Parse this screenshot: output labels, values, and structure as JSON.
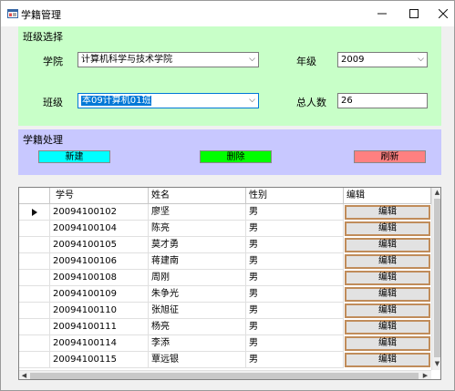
{
  "window": {
    "title": "学籍管理",
    "min_icon": "minimize-icon",
    "max_icon": "maximize-icon",
    "close_icon": "close-icon"
  },
  "class_panel": {
    "title": "班级选择",
    "college_label": "学院",
    "college_value": "计算机科学与技术学院",
    "grade_label": "年级",
    "grade_value": "2009",
    "class_label": "班级",
    "class_value": "本09计算机01班",
    "total_label": "总人数",
    "total_value": "26",
    "bg_color": "#c8ffc8"
  },
  "status_panel": {
    "title": "学籍处理",
    "new_label": "新建",
    "delete_label": "删除",
    "refresh_label": "刷新",
    "bg_color": "#c8c8ff"
  },
  "grid": {
    "columns": [
      "学号",
      "姓名",
      "性别",
      "编辑"
    ],
    "edit_label": "编辑",
    "rows": [
      {
        "id": "20094100102",
        "name": "廖坚",
        "sex": "男",
        "current": true
      },
      {
        "id": "20094100104",
        "name": "陈亮",
        "sex": "男"
      },
      {
        "id": "20094100105",
        "name": "莫才勇",
        "sex": "男"
      },
      {
        "id": "20094100106",
        "name": "蒋建南",
        "sex": "男"
      },
      {
        "id": "20094100108",
        "name": "周刚",
        "sex": "男"
      },
      {
        "id": "20094100109",
        "name": "朱争光",
        "sex": "男"
      },
      {
        "id": "20094100110",
        "name": "张旭征",
        "sex": "男"
      },
      {
        "id": "20094100111",
        "name": "杨亮",
        "sex": "男"
      },
      {
        "id": "20094100114",
        "name": "李添",
        "sex": "男"
      },
      {
        "id": "20094100115",
        "name": "覃远银",
        "sex": "男"
      }
    ]
  }
}
